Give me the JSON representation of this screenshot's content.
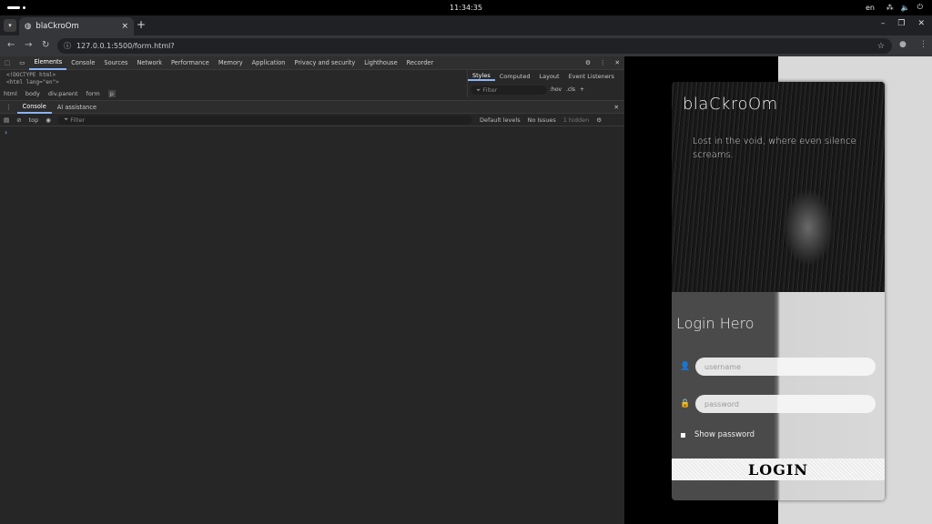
{
  "system": {
    "clock": "11:34:35",
    "lang": "en"
  },
  "browser": {
    "tab_title": "blaCkroOm",
    "url": "127.0.0.1:5500/form.html?",
    "new_tab": "+",
    "close_tab": "×"
  },
  "devtools": {
    "tabs": [
      "Elements",
      "Console",
      "Sources",
      "Network",
      "Performance",
      "Memory",
      "Application",
      "Privacy and security",
      "Lighthouse",
      "Recorder"
    ],
    "dom_lines": [
      "<!DOCTYPE html>",
      "<html lang=\"en\">"
    ],
    "breadcrumbs": [
      "html",
      "body",
      "div.parent",
      "form",
      "p"
    ],
    "styles_tabs": [
      "Styles",
      "Computed",
      "Layout",
      "Event Listeners"
    ],
    "styles_filter_placeholder": "Filter",
    "styles_buttons": [
      ":hov",
      ".cls",
      "+"
    ],
    "drawer_tabs": [
      "Console",
      "AI assistance"
    ],
    "console": {
      "context": "top",
      "filter_placeholder": "Filter",
      "levels": "Default levels",
      "issues": "No Issues",
      "hidden": "1 hidden",
      "prompt": "›"
    }
  },
  "page": {
    "brand": "blaCkroOm",
    "tagline": "Lost in the void, where even silence screams.",
    "login_title": "Login Hero",
    "username_placeholder": "username",
    "password_placeholder": "password",
    "show_password": "Show password",
    "login_button": "LOGIN"
  }
}
